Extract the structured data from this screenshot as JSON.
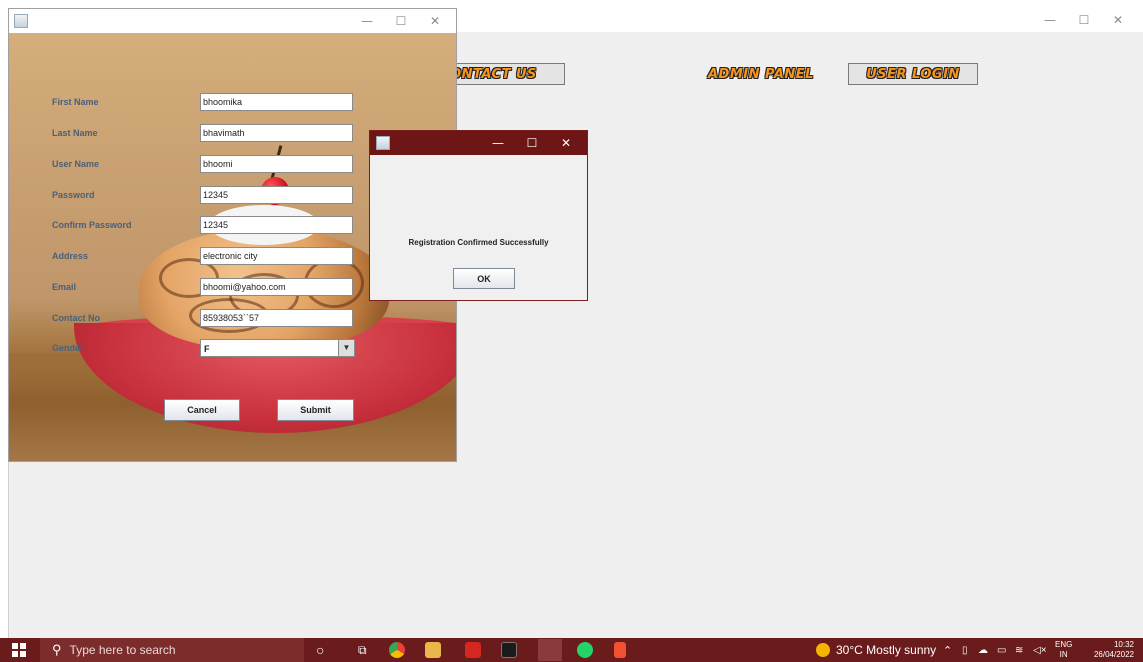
{
  "main_window": {
    "minimize": "—",
    "maximize": "☐",
    "close": "✕",
    "nav_buttons": {
      "contact_us": "CONTACT US",
      "admin_panel": "ADMIN PANEL",
      "user_login": "USER LOGIN"
    }
  },
  "registration_window": {
    "minimize": "—",
    "maximize": "☐",
    "close": "✕",
    "fields": [
      {
        "label": "First Name",
        "value": "bhoomika"
      },
      {
        "label": "Last Name",
        "value": "bhavimath"
      },
      {
        "label": "User Name",
        "value": "bhoomi"
      },
      {
        "label": "Password",
        "value": "12345"
      },
      {
        "label": "Confirm Password",
        "value": "12345"
      },
      {
        "label": "Address",
        "value": "electronic city"
      },
      {
        "label": "Email",
        "value": "bhoomi@yahoo.com"
      },
      {
        "label": "Contact No",
        "value": "85938053``57"
      }
    ],
    "gender": {
      "label": "Gender",
      "value": "F"
    },
    "cancel_label": "Cancel",
    "submit_label": "Submit"
  },
  "dialog": {
    "minimize": "—",
    "maximize": "☐",
    "close": "✕",
    "message": "Registration Confirmed Successfully",
    "ok_label": "OK"
  },
  "taskbar": {
    "search_placeholder": "Type here to search",
    "weather": "30°C  Mostly sunny",
    "language_top": "ENG",
    "language_bottom": "IN",
    "time": "10:32",
    "date": "26/04/2022",
    "apps": [
      "cortana-icon",
      "task-view-icon",
      "chrome-icon",
      "file-explorer-icon",
      "acrobat-icon",
      "terminal-icon",
      "java-icon",
      "whatsapp-icon",
      "git-icon"
    ]
  },
  "colors": {
    "taskbar": "#6a1c1c",
    "dialog_titlebar": "#6e1515",
    "nav_text": "#f7941d",
    "label_text": "#48607a"
  }
}
